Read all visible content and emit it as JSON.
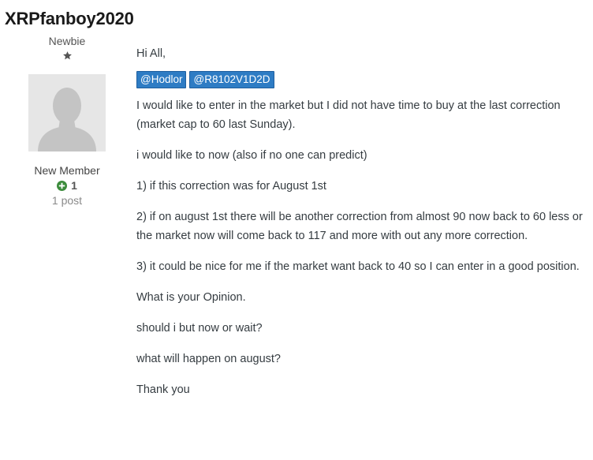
{
  "author": {
    "username": "XRPfanboy2020",
    "rank_title": "Newbie",
    "rank_icon": "star-icon",
    "avatar_icon": "default-avatar-icon",
    "member_group": "New Member",
    "reputation": "1",
    "reputation_icon": "plus-circle-icon",
    "post_count": "1 post"
  },
  "post": {
    "greeting": "Hi All,",
    "mentions": [
      "@Hodlor",
      "@R8102V1D2D"
    ],
    "paragraphs": [
      "I would like to enter in the market but I did not have time to buy at the last correction (market cap to 60 last Sunday).",
      "i would like to now (also if no one can predict)",
      "1) if this correction was for August 1st",
      "2) if on august 1st there will be another correction from almost 90 now back to 60 less or the market now will come back to 117 and more with out any more correction.",
      "3) it could be nice for me if the market want back to 40 so I can enter in a good position.",
      "What is your Opinion.",
      "should i but now or wait?",
      "what will happen on august?",
      "Thank you"
    ]
  },
  "colors": {
    "mention_bg": "#2e7cc4",
    "reputation_green": "#3c8c3c",
    "text": "#353c41"
  }
}
